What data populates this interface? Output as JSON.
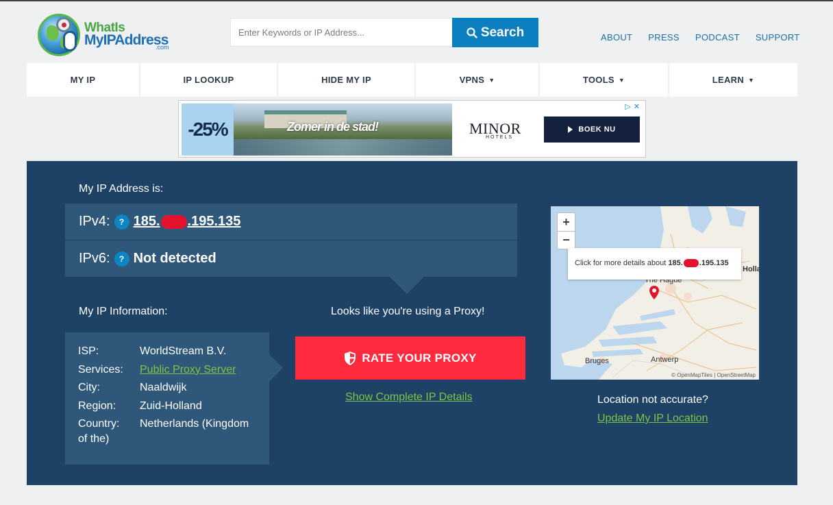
{
  "header": {
    "logo_line1": "WhatIs",
    "logo_line2": "MyIPAddress",
    "logo_suffix": ".com",
    "search_placeholder": "Enter Keywords or IP Address...",
    "search_button": "Search",
    "top_links": [
      "ABOUT",
      "PRESS",
      "PODCAST",
      "SUPPORT"
    ]
  },
  "nav": [
    {
      "label": "MY IP",
      "caret": ""
    },
    {
      "label": "IP LOOKUP",
      "caret": ""
    },
    {
      "label": "HIDE MY IP",
      "caret": ""
    },
    {
      "label": "VPNS",
      "caret": "▼"
    },
    {
      "label": "TOOLS",
      "caret": "▼"
    },
    {
      "label": "LEARN",
      "caret": "▼"
    }
  ],
  "ad": {
    "discount": "-25%",
    "tagline": "Zomer in de stad!",
    "brand": "MINOR",
    "brand_sub": "HOTELS",
    "cta": "BOEK NU"
  },
  "ip": {
    "heading": "My IP Address is:",
    "ipv4_label": "IPv4:",
    "ipv4_prefix": "185.",
    "ipv4_suffix": ".195.135",
    "ipv6_label": "IPv6:",
    "ipv6_value": "Not detected",
    "help_symbol": "?"
  },
  "info": {
    "heading": "My IP Information:",
    "rows": [
      {
        "key": "ISP:",
        "value": "WorldStream B.V."
      },
      {
        "key": "Services:",
        "value": "Public Proxy Server"
      },
      {
        "key": "City:",
        "value": "Naaldwijk"
      },
      {
        "key": "Region:",
        "value": "Zuid-Holland"
      },
      {
        "key": "Country:",
        "value": "Netherlands (Kingdom"
      }
    ],
    "country_wrap": "of the)"
  },
  "proxy": {
    "message": "Looks like you're using a Proxy!",
    "button": "RATE YOUR PROXY",
    "details_link": "Show Complete IP Details"
  },
  "map": {
    "zoom_in": "+",
    "zoom_out": "−",
    "tooltip_text": "Click for more details about",
    "tooltip_ip_prefix": "185.",
    "tooltip_ip_suffix": ".195.135",
    "cities": [
      "Bruges",
      "Antwerp",
      "The Hague",
      "Holland"
    ],
    "attribution": "© OpenMapTiles | OpenStreetMap",
    "inaccurate": "Location not accurate?",
    "update_link": "Update My IP Location"
  },
  "colors": {
    "panel": "#1e4266",
    "row": "#2f5779",
    "accent_red": "#ff2a3d",
    "link_green": "#7cc546",
    "search_blue": "#0b7fc0"
  }
}
